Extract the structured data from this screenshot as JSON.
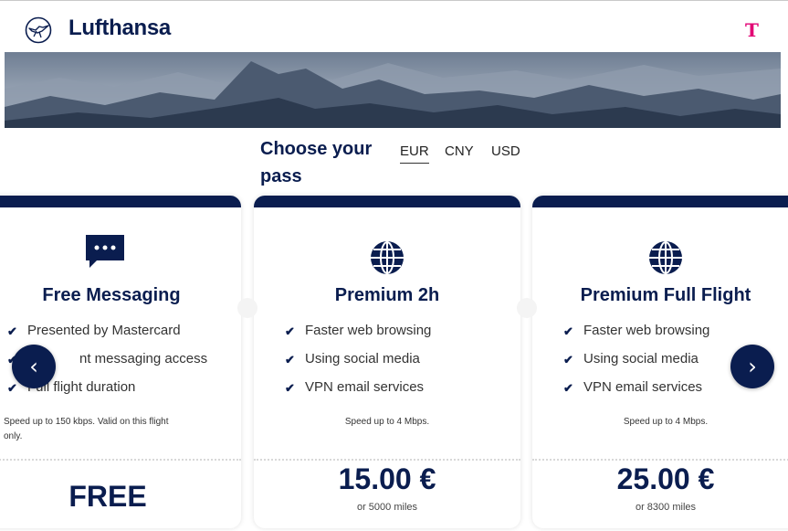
{
  "header": {
    "brand": "Lufthansa",
    "partner_logo": "T",
    "logo_icon": "crane-logo-icon"
  },
  "banner": {
    "image": "mountain-landscape"
  },
  "pass_selector": {
    "title": "Choose your pass",
    "currencies": [
      {
        "label": "EUR",
        "selected": true
      },
      {
        "label": "CNY",
        "selected": false
      },
      {
        "label": "USD",
        "selected": false
      }
    ]
  },
  "cards": [
    {
      "icon": "chat-bubble-icon",
      "title": "Free Messaging",
      "features": [
        "Presented by Mastercard",
        "Instant messaging access",
        "Full flight duration"
      ],
      "features_visible": [
        "Presented by Mastercard",
        "nt messaging access",
        "Full flight duration"
      ],
      "note": "Speed up to 150 kbps. Valid on this flight only.",
      "note_visible": [
        "Speed up to 150 kbps. Valid on this flight",
        "only."
      ],
      "price": "FREE"
    },
    {
      "icon": "globe-icon",
      "title": "Premium 2h",
      "features": [
        "Faster web browsing",
        "Using social media",
        "VPN email services"
      ],
      "note": "Speed up to 4 Mbps.",
      "price": "15.00 €",
      "miles": "or 5000 miles"
    },
    {
      "icon": "globe-icon",
      "title": "Premium Full Flight",
      "features": [
        "Faster web browsing",
        "Using social media",
        "VPN email services"
      ],
      "note": "Speed up to 4 Mbps.",
      "price": "25.00 €",
      "miles": "or 8300 miles"
    }
  ],
  "carousel": {
    "prev_icon": "chevron-left-icon",
    "next_icon": "chevron-right-icon"
  },
  "colors": {
    "brand_navy": "#0a1d4f",
    "telekom_magenta": "#e20074"
  }
}
